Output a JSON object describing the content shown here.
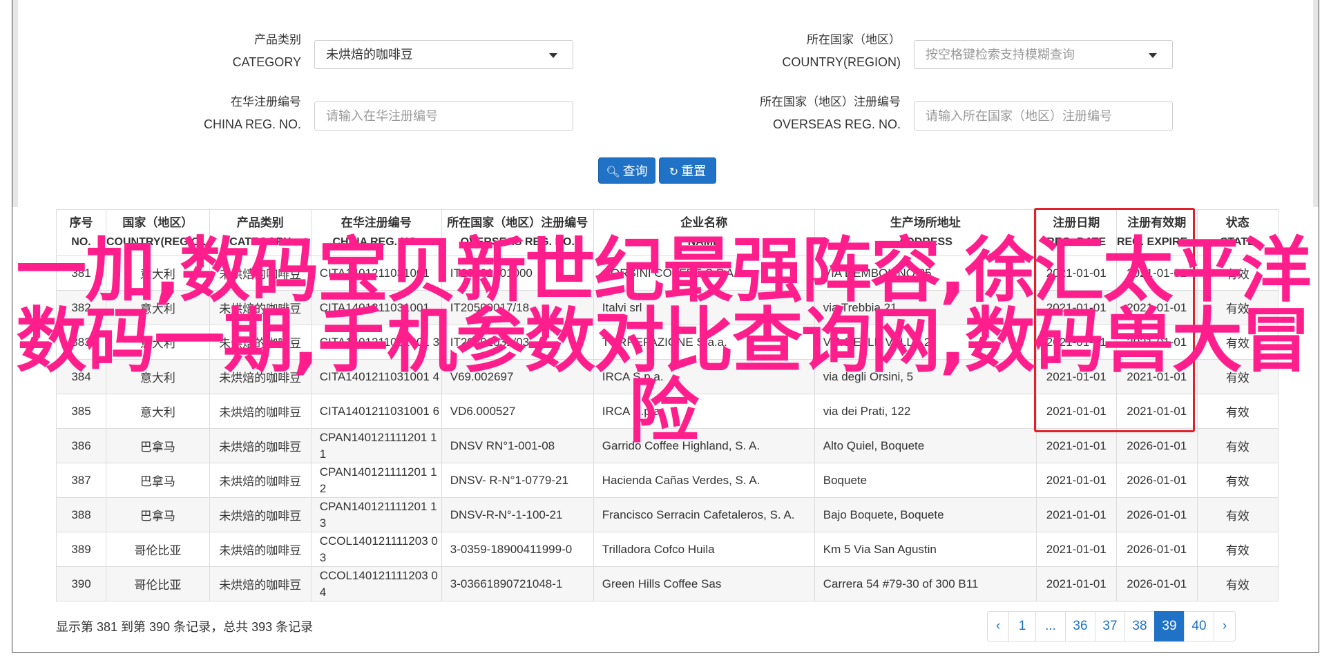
{
  "form": {
    "category": {
      "label_cn": "产品类别",
      "label_en": "CATEGORY",
      "value": "未烘焙的咖啡豆"
    },
    "country": {
      "label_cn": "所在国家（地区）",
      "label_en": "COUNTRY(REGION)",
      "placeholder": "按空格键检索支持模糊查询"
    },
    "china_reg": {
      "label_cn": "在华注册编号",
      "label_en": "CHINA REG. NO.",
      "placeholder": "请输入在华注册编号"
    },
    "overseas_reg": {
      "label_cn": "所在国家（地区）注册编号",
      "label_en": "OVERSEAS REG. NO.",
      "placeholder": "请输入所在国家（地区）注册编号"
    },
    "search_label": "查询",
    "reset_label": "重置"
  },
  "table": {
    "headers": [
      {
        "cn": "序号",
        "en": "NO."
      },
      {
        "cn": "国家（地区）",
        "en": "COUNTRY(REGIO..."
      },
      {
        "cn": "产品类别",
        "en": "CATEGORY"
      },
      {
        "cn": "在华注册编号",
        "en": "CHINA REG. NO."
      },
      {
        "cn": "所在国家（地区）注册编号",
        "en": "OVERSEAS REG. NO."
      },
      {
        "cn": "企业名称",
        "en": "NAME"
      },
      {
        "cn": "生产场所地址",
        "en": "ADDRESS"
      },
      {
        "cn": "注册日期",
        "en": "REG. DATE"
      },
      {
        "cn": "注册有效期",
        "en": "REG. EXPIRE..."
      },
      {
        "cn": "状态",
        "en": "STATE"
      }
    ],
    "rows": [
      [
        "381",
        "意大利",
        "未烘焙的咖啡豆",
        "CITA1401211031001",
        "IT20501001000",
        "CORSINI COFFEE S.P.A.",
        "VIA DEMBOLINO 85",
        "2021-01-01",
        "2021-01-01",
        "有效"
      ],
      [
        "382",
        "意大利",
        "未烘焙的咖啡豆",
        "CITA1401211031001",
        "IT20509017/18",
        "Italvi srl",
        "via Trebbia 21",
        "2021-01-01",
        "2021-01-01",
        "有效"
      ],
      [
        "383",
        "意大利",
        "未烘焙的咖啡豆",
        "CITA1401211031001 3",
        "IT20501031/03",
        "TORREFAZIONE S.a.a.",
        "VIA DELLE VALLE 2",
        "2021-01-01",
        "2021-01-01",
        "有效"
      ],
      [
        "384",
        "意大利",
        "未烘焙的咖啡豆",
        "CITA1401211031001 4",
        "V69.002697",
        "IRCA S.p.a.",
        "via degli Orsini, 5",
        "2021-01-01",
        "2021-01-01",
        "有效"
      ],
      [
        "385",
        "意大利",
        "未烘焙的咖啡豆",
        "CITA1401211031001 6",
        "VD6.000527",
        "IRCA S.p.a.",
        "via dei Prati, 122",
        "2021-01-01",
        "2021-01-01",
        "有效"
      ],
      [
        "386",
        "巴拿马",
        "未烘焙的咖啡豆",
        "CPAN140121111201 11",
        "DNSV RN°1-001-08",
        "Garrido Coffee Highland, S. A.",
        "Alto Quiel, Boquete",
        "2021-01-01",
        "2026-01-01",
        "有效"
      ],
      [
        "387",
        "巴拿马",
        "未烘焙的咖啡豆",
        "CPAN140121111201 12",
        "DNSV- R-N°1-0779-21",
        "Hacienda Cañas Verdes, S. A.",
        "Boquete",
        "2021-01-01",
        "2026-01-01",
        "有效"
      ],
      [
        "388",
        "巴拿马",
        "未烘焙的咖啡豆",
        "CPAN140121111201 13",
        "DNSV-R-N°-1-100-21",
        "Francisco Serracin Cafetaleros, S. A.",
        "Bajo Boquete, Boquete",
        "2021-01-01",
        "2026-01-01",
        "有效"
      ],
      [
        "389",
        "哥伦比亚",
        "未烘焙的咖啡豆",
        "CCOL140121111203 03",
        "3-0359-18900411999-0",
        "Trilladora Cofco Huila",
        "Km 5 Via San Agustin",
        "2021-01-01",
        "2026-01-01",
        "有效"
      ],
      [
        "390",
        "哥伦比亚",
        "未烘焙的咖啡豆",
        "CCOL140121111203 04",
        "3-03661890721048-1",
        "Green Hills Coffee Sas",
        "Carrera 54 #79-30 of 300 B11",
        "2021-01-01",
        "2026-01-01",
        "有效"
      ]
    ]
  },
  "overlay_text": "一加,数码宝贝新世纪最强阵容,徐汇太平洋数码一期,手机参数对比查询网,数码兽大冒险",
  "footer": {
    "info": "显示第 381 到第 390 条记录，总共 393 条记录",
    "pages": [
      "‹",
      "1",
      "...",
      "36",
      "37",
      "38",
      "39",
      "40",
      "›"
    ],
    "active_page": "39"
  },
  "colors": {
    "accent": "#1f72c6",
    "highlight": "#e0202a",
    "overlay": "#ff1e8c"
  }
}
